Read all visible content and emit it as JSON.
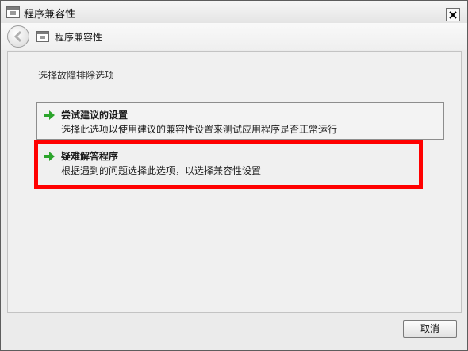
{
  "window": {
    "title": "程序兼容性",
    "close_label": "×"
  },
  "nav": {
    "title": "程序兼容性"
  },
  "main": {
    "heading": "选择故障排除选项",
    "options": [
      {
        "title": "尝试建议的设置",
        "description": "选择此选项以使用建议的兼容性设置来测试应用程序是否正常运行"
      },
      {
        "title": "疑难解答程序",
        "description": "根据遇到的问题选择此选项，以选择兼容性设置"
      }
    ]
  },
  "footer": {
    "cancel_label": "取消"
  },
  "colors": {
    "highlight": "#ff0000",
    "arrow": "#2ca52c"
  }
}
